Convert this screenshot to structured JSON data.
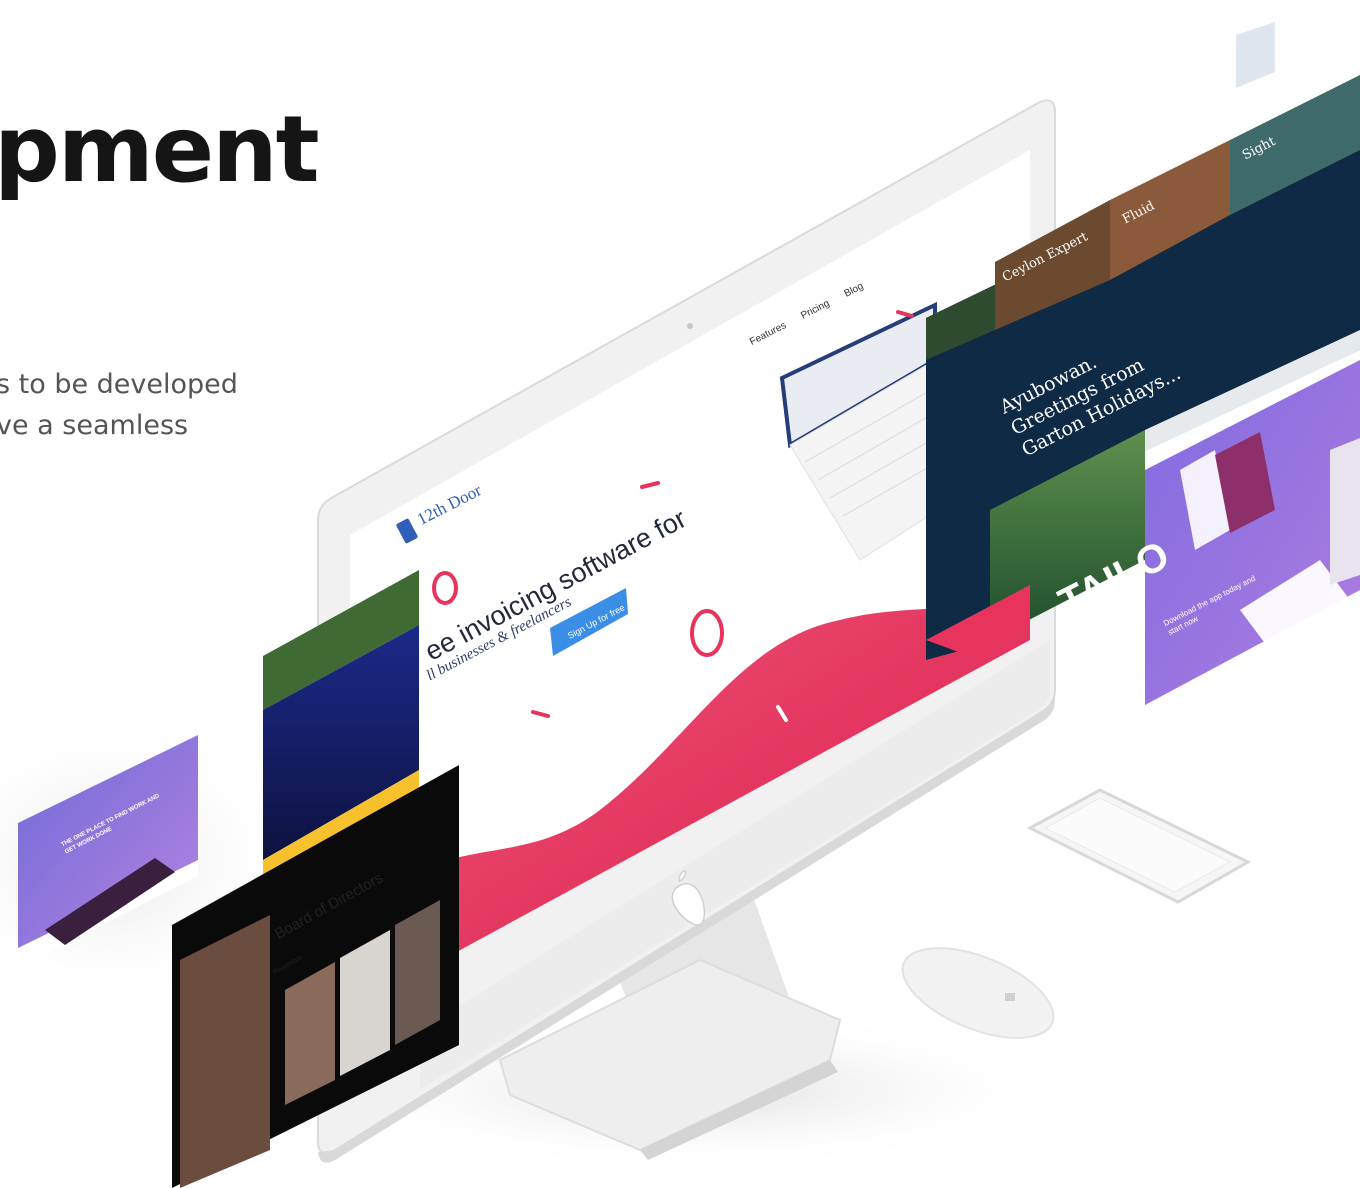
{
  "headline": "pment",
  "description": [
    "s to be developed",
    "ve a  seamless"
  ],
  "screens": {
    "invoice": {
      "logo": "12th Door",
      "nav": [
        "Features",
        "Pricing",
        "Blog"
      ],
      "headline": "ee invoicing software for",
      "subheadline": "ll businesses & freelancers",
      "cta": "Sign Up for free"
    },
    "travel": {
      "greeting": "Ayubowan.",
      "line1": "Greetings from",
      "line2": "Garton Holidays...",
      "tiles": [
        "Ceylon Expert",
        "Fluid",
        "Sight"
      ],
      "banner": "TAILO"
    },
    "corporate": {
      "title": "Board of Directors",
      "link": "Readmore"
    },
    "app_purple": {
      "headline": "Download the app today and start now"
    },
    "app_left": {
      "headline": "THE ONE PLACE TO FIND WORK AND GET WORK DONE"
    }
  },
  "colors": {
    "accent_pink": "#e8345c",
    "navy": "#0f2a45",
    "purple": "#8b6fd8",
    "yellow": "#f7c12d",
    "blue_cta": "#3a8ee6"
  },
  "icons": [
    "apple-logo-icon"
  ]
}
